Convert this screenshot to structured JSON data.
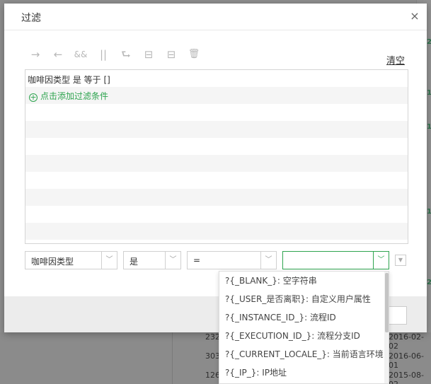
{
  "background": {
    "rows": [
      {
        "num": "232",
        "date": "2016-02-02"
      },
      {
        "num": "303",
        "date": "2016-06-01"
      },
      {
        "num": "126",
        "date": "2015-08-02"
      }
    ]
  },
  "dialog": {
    "title": "过滤",
    "close_icon": "×",
    "clear_label": "清空",
    "toolbar_icons": [
      "→",
      "←",
      "&&",
      "||",
      "⮑",
      "⊟",
      "⊟",
      "🗑"
    ],
    "conditions": [
      {
        "text": "咖啡因类型 是 等于 []"
      }
    ],
    "add_condition_label": "点击添加过滤条件",
    "field_select": {
      "value": "咖啡因类型"
    },
    "relation_select": {
      "value": "是"
    },
    "operator_select": {
      "value": "="
    },
    "value_select": {
      "value": ""
    }
  },
  "dropdown": {
    "items": [
      "?{_BLANK_}: 空字符串",
      "?{_USER_是否离职}: 自定义用户属性",
      "?{_INSTANCE_ID_}: 流程ID",
      "?{_EXECUTION_ID_}: 流程分支ID",
      "?{_CURRENT_LOCALE_}: 当前语言环境",
      "?{_IP_}: IP地址"
    ]
  },
  "colors": {
    "accent": "#2ea44f",
    "overlay": "#8e8e8e"
  }
}
